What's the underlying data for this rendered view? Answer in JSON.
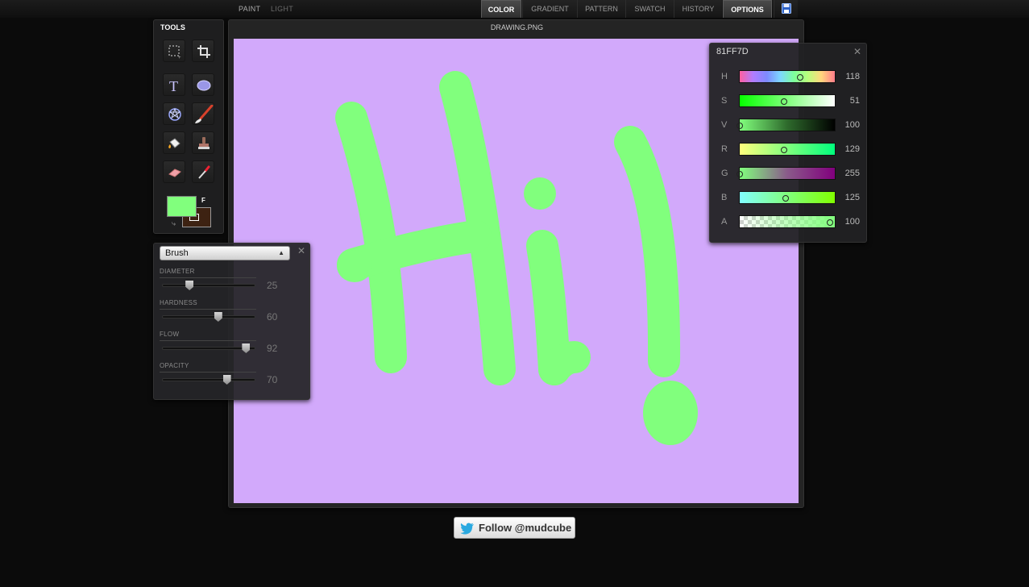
{
  "topbar": {
    "modes": [
      "PAINT",
      "LIGHT"
    ],
    "tabs": [
      "COLOR",
      "GRADIENT",
      "PATTERN",
      "SWATCH",
      "HISTORY",
      "OPTIONS"
    ],
    "active_tabs": [
      "COLOR",
      "OPTIONS"
    ],
    "save_icon": "save-icon"
  },
  "tools": {
    "title": "TOOLS",
    "items": [
      "marquee-icon",
      "crop-icon",
      "text-icon",
      "ellipse-icon",
      "shape-icon",
      "brush-icon",
      "bucket-icon",
      "stamp-icon",
      "eraser-icon",
      "eyedropper-icon"
    ],
    "foreground_color": "#81ff7d",
    "background_color": "#3d2212",
    "fg_label": "F"
  },
  "canvas": {
    "title": "DRAWING.PNG",
    "background": "#d2a9fb",
    "stroke_color": "#81ff7d"
  },
  "brush_panel": {
    "tool": "Brush",
    "sliders": [
      {
        "label": "DIAMETER",
        "value": "25",
        "level": 0.27
      },
      {
        "label": "HARDNESS",
        "value": "60",
        "level": 0.6
      },
      {
        "label": "FLOW",
        "value": "92",
        "level": 0.92
      },
      {
        "label": "OPACITY",
        "value": "70",
        "level": 0.7
      }
    ]
  },
  "color_panel": {
    "hex": "81FF7D",
    "channels": [
      {
        "label": "H",
        "value": "118",
        "level": 0.67
      },
      {
        "label": "S",
        "value": "51",
        "level": 0.49
      },
      {
        "label": "V",
        "value": "100",
        "level": 0.0
      },
      {
        "label": "R",
        "value": "129",
        "level": 0.49
      },
      {
        "label": "G",
        "value": "255",
        "level": 0.0
      },
      {
        "label": "B",
        "value": "125",
        "level": 0.51
      },
      {
        "label": "A",
        "value": "100",
        "level": 1.0
      }
    ]
  },
  "follow_button": {
    "label": "Follow @mudcube",
    "icon": "twitter-bird-icon"
  }
}
